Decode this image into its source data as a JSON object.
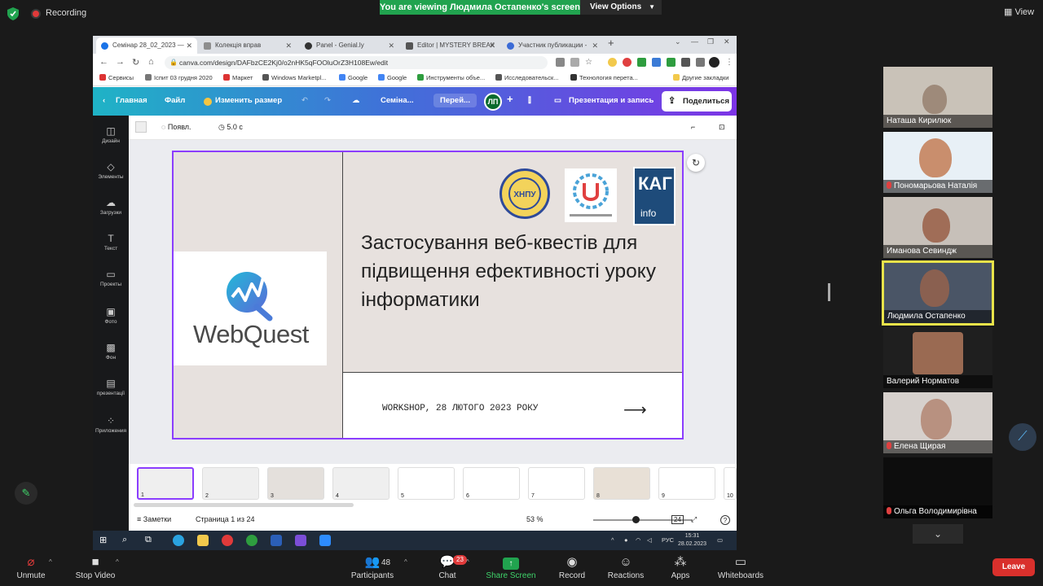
{
  "zoom": {
    "recording_label": "Recording",
    "viewing_banner": "You are viewing Людмила Остапенко's screen",
    "view_options": "View Options",
    "view_label": "View"
  },
  "browser": {
    "tabs": [
      {
        "label": "Семінар 28_02_2023 — ",
        "color": "#1a73e8"
      },
      {
        "label": "Колекція вправ",
        "color": "#8e8e8e"
      },
      {
        "label": "Panel - Genial.ly",
        "color": "#333333"
      },
      {
        "label": "Editor | MYSTERY BREAK",
        "color": "#555555"
      },
      {
        "label": "Участник публикации -",
        "color": "#3b6bd6"
      }
    ],
    "url": "canva.com/design/DAFbzCE2Kj0/o2nHK5qFOOluOrZ3H108Ew/edit",
    "bookmarks": [
      "Сервисы",
      "Іспит 03 грудня 2020",
      "Маркет",
      "Windows Marketpl...",
      "Google",
      "Google",
      "Инструменты объе...",
      "Исследовательск...",
      "Технология перета...",
      "Другие закладки"
    ]
  },
  "canva": {
    "home": "Главная",
    "file": "Файл",
    "resize": "Изменить размер",
    "doc_title": "Семіна...",
    "go": "Перей...",
    "avatar": "ЛП",
    "present": "Презентация и запись",
    "share": "Поделиться",
    "rail": [
      "Дизайн",
      "Элементы",
      "Загрузки",
      "Текст",
      "Проекты",
      "Фото",
      "Фон",
      "презентації",
      "Приложения"
    ],
    "toolbar_appear": "Появл.",
    "toolbar_duration": "5.0 с",
    "notes": "Заметки",
    "page_info": "Страница 1 из 24",
    "zoom_level": "53 %",
    "grid_count": "24",
    "thumb_numbers": [
      "1",
      "2",
      "3",
      "4",
      "5",
      "6",
      "7",
      "8",
      "9",
      "10"
    ]
  },
  "slide": {
    "logo_text": "WebQuest",
    "title": "Застосування веб-квестів для підвищення ефективності уроку інформатики",
    "workshop": "WORKSHOP, 28 ЛЮТОГО 2023 РОКУ",
    "arrow": "⟶",
    "logo1_text": "ХНПУ",
    "logo3_top": "КАГ",
    "logo3_bottom": "info"
  },
  "taskbar": {
    "lang": "РУС",
    "time": "15:31",
    "date": "28.02.2023"
  },
  "participants": [
    {
      "name": "Наташа Кирилюк",
      "muted": false
    },
    {
      "name": "Пономарьова Наталія",
      "muted": true
    },
    {
      "name": "Иманова Севиндж",
      "muted": false
    },
    {
      "name": "Людмила Остапенко",
      "muted": false
    },
    {
      "name": "Валерий Норматов",
      "muted": false
    },
    {
      "name": "Елена Щирая",
      "muted": true
    },
    {
      "name": "Ольга Володимирівна",
      "muted": true
    }
  ],
  "controls": {
    "unmute": "Unmute",
    "stop_video": "Stop Video",
    "participants": "Participants",
    "participants_count": "48",
    "chat": "Chat",
    "chat_badge": "23",
    "share_screen": "Share Screen",
    "record": "Record",
    "reactions": "Reactions",
    "apps": "Apps",
    "whiteboards": "Whiteboards",
    "leave": "Leave"
  },
  "colors": {
    "accent_green": "#21a34f",
    "canva_purple": "#8b3dff",
    "leave_red": "#d9302c",
    "active_speaker": "#e8e34a"
  }
}
